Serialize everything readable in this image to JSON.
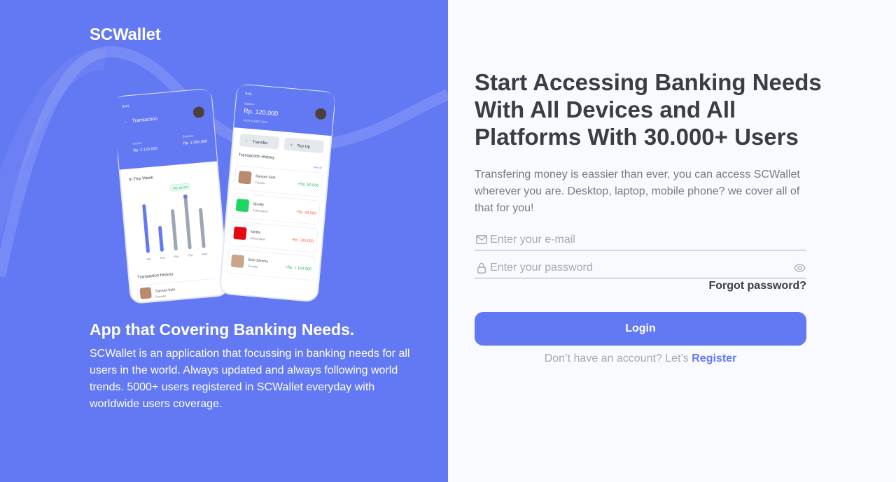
{
  "brand": {
    "name": "SCWallet"
  },
  "left": {
    "title": "App that Covering Banking Needs.",
    "description": "SCWallet is an application that focussing in banking needs for all users in the world. Always updated and always following world trends. 5000+ users registered in SCWallet everyday with worldwide users coverage."
  },
  "phone_back": {
    "time": "9:41",
    "header": "Transaction",
    "income_label": "Income",
    "income_value": "Rp. 2.120.000",
    "expense_label": "Expense",
    "expense_value": "Rp. 1.560.000",
    "week_title": "In This Week",
    "bar_tooltip": "+Rp. 65.000",
    "days": [
      "Sat",
      "Sun",
      "Mon",
      "Tue",
      "Wed"
    ],
    "bars": [
      0.85,
      0.45,
      0.72,
      0.92,
      0.7
    ],
    "history_title": "Transaction History",
    "row_name": "Samuel Suhi",
    "row_type": "Transfer"
  },
  "phone_front": {
    "time": "9:41",
    "balance_label": "Balance",
    "balance_value": "Rp. 120.000",
    "phone": "+62 813-9387-7946",
    "transfer_label": "Transfer",
    "topup_label": "Top Up",
    "history_title": "Transaction History",
    "see_all": "See all",
    "rows": [
      {
        "name": "Samuel Suhi",
        "type": "Transfer",
        "amount": "+Rp. 50.000",
        "positive": true
      },
      {
        "name": "Spotify",
        "type": "Subscription",
        "amount": "-Rp. 49.000",
        "positive": false
      },
      {
        "name": "Netflix",
        "type": "Subscription",
        "amount": "-Rp. 149.000",
        "positive": false
      },
      {
        "name": "Bobi Sammy",
        "type": "Transfer",
        "amount": "+Rp. 1.150.000",
        "positive": true
      }
    ]
  },
  "right": {
    "headline": "Start Accessing Banking Needs With All Devices and All Platforms With 30.000+ Users",
    "subtext": "Transfering money is eassier than ever, you can access SCWallet wherever you are. Desktop, laptop, mobile phone? we cover all of that for you!",
    "email_placeholder": "Enter your e-mail",
    "password_placeholder": "Enter your password",
    "forgot": "Forgot password?",
    "login": "Login",
    "register_prompt": "Don’t have an account? Let’s",
    "register_link": "Register"
  },
  "colors": {
    "primary": "#6379F4",
    "text_dark": "#3A3D42",
    "text_muted": "#7A7886",
    "positive": "#1EC15F",
    "negative": "#FF5B37"
  }
}
